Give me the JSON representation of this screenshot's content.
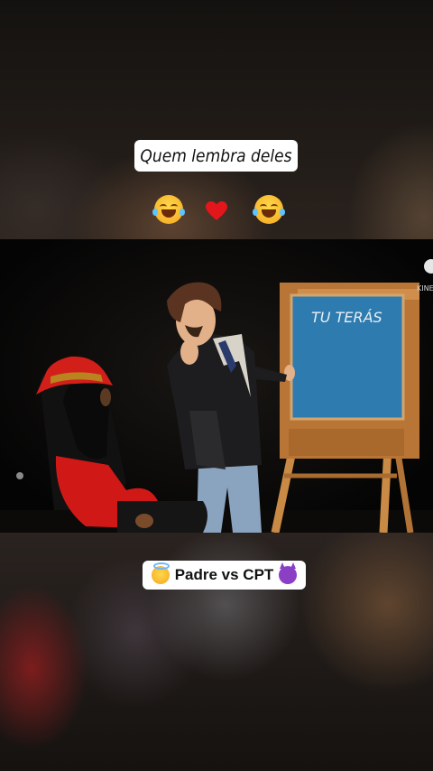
{
  "captions": {
    "top": "Quem lembra deles",
    "bottom": "Padre vs CPT"
  },
  "emojis": {
    "row": [
      "laughing-tears",
      "red-heart",
      "laughing-tears"
    ],
    "bottom_left": "angel-face",
    "bottom_right": "purple-devil"
  },
  "video": {
    "chalkboard_text": "TU TERÁS",
    "watermark": "KINE"
  },
  "colors": {
    "caption_bg": "#ffffff",
    "chalkboard": "#2e7bb0",
    "easel_wood": "#c07a35",
    "hat": "#d21f1a"
  }
}
